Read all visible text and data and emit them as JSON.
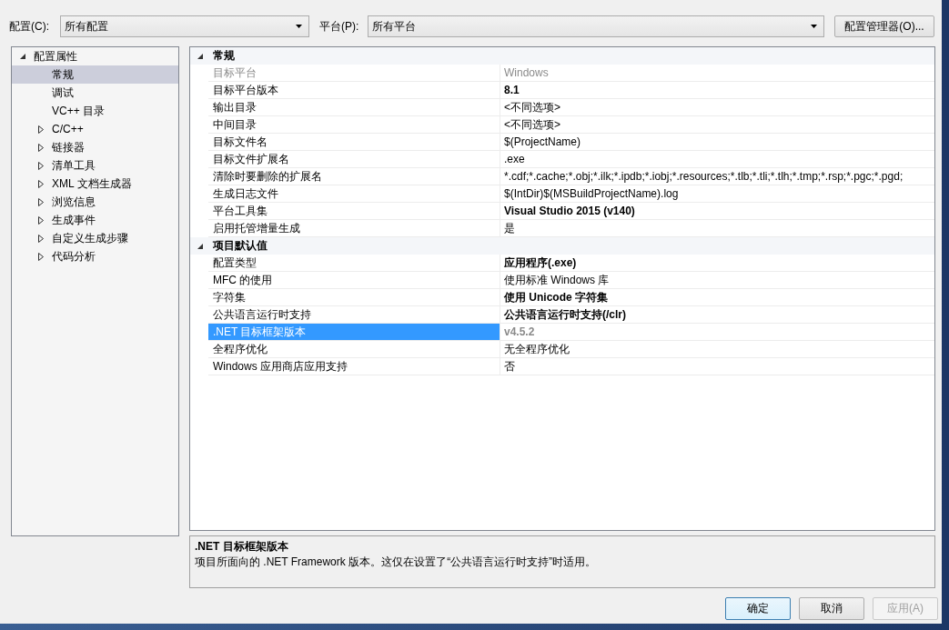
{
  "toolbar": {
    "configuration": {
      "label": "配置(C):",
      "value": "所有配置"
    },
    "platform": {
      "label": "平台(P):",
      "value": "所有平台"
    },
    "manager_button": "配置管理器(O)..."
  },
  "tree": [
    {
      "label": "配置属性",
      "kind": "group",
      "expanded": true,
      "selected": false,
      "children": [
        {
          "label": "常规",
          "kind": "page",
          "selected": true
        },
        {
          "label": "调试",
          "kind": "page",
          "selected": false
        },
        {
          "label": "VC++ 目录",
          "kind": "page",
          "selected": false
        },
        {
          "label": "C/C++",
          "kind": "group",
          "expanded": false,
          "selected": false
        },
        {
          "label": "链接器",
          "kind": "group",
          "expanded": false,
          "selected": false
        },
        {
          "label": "清单工具",
          "kind": "group",
          "expanded": false,
          "selected": false
        },
        {
          "label": "XML 文档生成器",
          "kind": "group",
          "expanded": false,
          "selected": false
        },
        {
          "label": "浏览信息",
          "kind": "group",
          "expanded": false,
          "selected": false
        },
        {
          "label": "生成事件",
          "kind": "group",
          "expanded": false,
          "selected": false
        },
        {
          "label": "自定义生成步骤",
          "kind": "group",
          "expanded": false,
          "selected": false
        },
        {
          "label": "代码分析",
          "kind": "group",
          "expanded": false,
          "selected": false
        }
      ]
    }
  ],
  "property_grid": {
    "categories": [
      {
        "title": "常规",
        "expanded": true,
        "properties": [
          {
            "name": "目标平台",
            "value": "Windows",
            "selected": false,
            "bold": false,
            "disabled": true
          },
          {
            "name": "目标平台版本",
            "value": "8.1",
            "selected": false,
            "bold": true,
            "disabled": false
          },
          {
            "name": "输出目录",
            "value": "<不同选项>",
            "selected": false,
            "bold": false,
            "disabled": false
          },
          {
            "name": "中间目录",
            "value": "<不同选项>",
            "selected": false,
            "bold": false,
            "disabled": false
          },
          {
            "name": "目标文件名",
            "value": "$(ProjectName)",
            "selected": false,
            "bold": false,
            "disabled": false
          },
          {
            "name": "目标文件扩展名",
            "value": ".exe",
            "selected": false,
            "bold": false,
            "disabled": false
          },
          {
            "name": "清除时要删除的扩展名",
            "value": "*.cdf;*.cache;*.obj;*.ilk;*.ipdb;*.iobj;*.resources;*.tlb;*.tli;*.tlh;*.tmp;*.rsp;*.pgc;*.pgd;",
            "selected": false,
            "bold": false,
            "disabled": false
          },
          {
            "name": "生成日志文件",
            "value": "$(IntDir)$(MSBuildProjectName).log",
            "selected": false,
            "bold": false,
            "disabled": false
          },
          {
            "name": "平台工具集",
            "value": "Visual Studio 2015 (v140)",
            "selected": false,
            "bold": true,
            "disabled": false
          },
          {
            "name": "启用托管增量生成",
            "value": "是",
            "selected": false,
            "bold": false,
            "disabled": false
          }
        ]
      },
      {
        "title": "项目默认值",
        "expanded": true,
        "properties": [
          {
            "name": "配置类型",
            "value": "应用程序(.exe)",
            "selected": false,
            "bold": true,
            "disabled": false
          },
          {
            "name": "MFC 的使用",
            "value": "使用标准 Windows 库",
            "selected": false,
            "bold": false,
            "disabled": false
          },
          {
            "name": "字符集",
            "value": "使用 Unicode 字符集",
            "selected": false,
            "bold": true,
            "disabled": false
          },
          {
            "name": "公共语言运行时支持",
            "value": "公共语言运行时支持(/clr)",
            "selected": false,
            "bold": true,
            "disabled": false
          },
          {
            "name": ".NET 目标框架版本",
            "value": "v4.5.2",
            "selected": true,
            "bold": true,
            "disabled": true
          },
          {
            "name": "全程序优化",
            "value": "无全程序优化",
            "selected": false,
            "bold": false,
            "disabled": false
          },
          {
            "name": "Windows 应用商店应用支持",
            "value": "否",
            "selected": false,
            "bold": false,
            "disabled": false
          }
        ]
      }
    ]
  },
  "description": {
    "title": ".NET 目标框架版本",
    "text": "项目所面向的 .NET Framework 版本。这仅在设置了“公共语言运行时支持”时适用。"
  },
  "buttons": [
    {
      "label": "确定",
      "default": true,
      "disabled": false
    },
    {
      "label": "取消",
      "default": false,
      "disabled": false
    },
    {
      "label": "应用(A)",
      "default": false,
      "disabled": true
    }
  ]
}
